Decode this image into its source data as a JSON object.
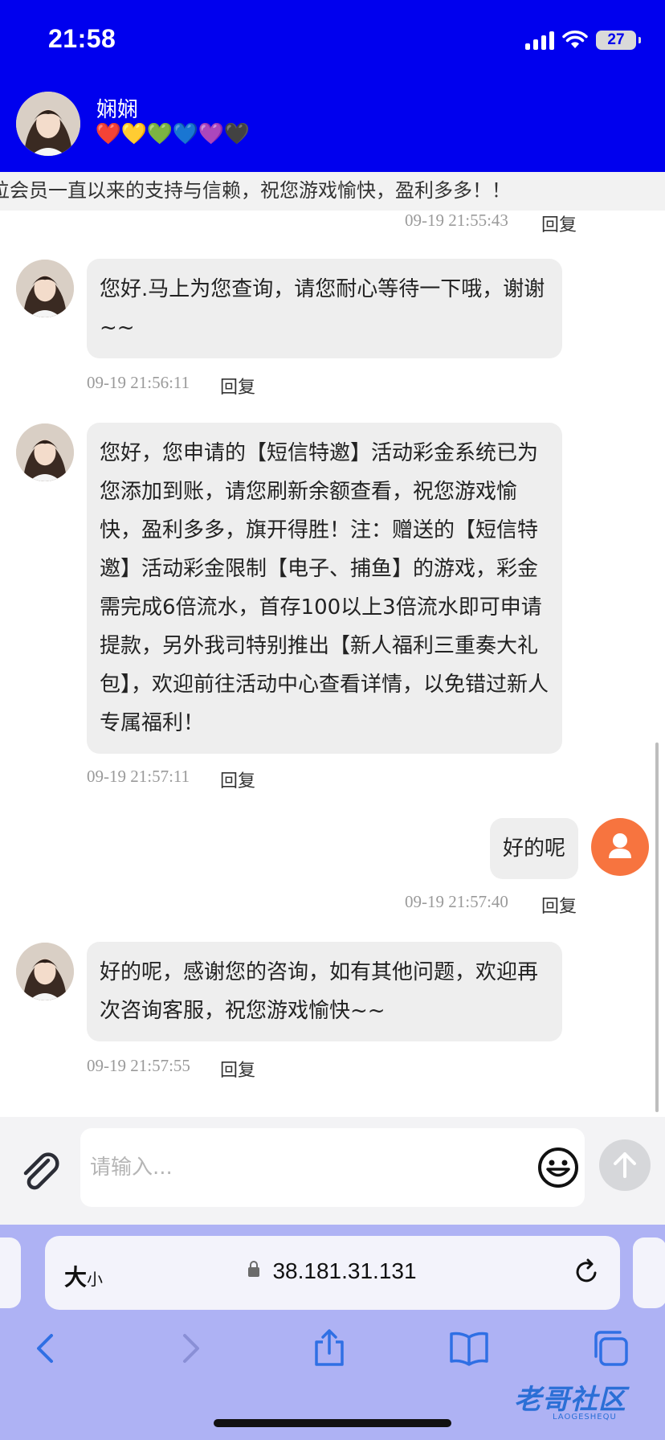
{
  "status_bar": {
    "time": "21:58",
    "battery": "27"
  },
  "header": {
    "name": "娴娴",
    "hearts": [
      "❤️",
      "💛",
      "💚",
      "💙",
      "💜",
      "🖤"
    ]
  },
  "notice": {
    "text": "位会员一直以来的支持与信赖，祝您游戏愉快，盈利多多！！"
  },
  "messages": [
    {
      "side": "right",
      "time": "09-19 21:55:43",
      "reply_label": "回复"
    },
    {
      "side": "left",
      "text": "您好.马上为您查询，请您耐心等待一下哦，谢谢~~",
      "time": "09-19 21:56:11",
      "reply_label": "回复"
    },
    {
      "side": "left",
      "text": "您好，您申请的【短信特邀】活动彩金系统已为您添加到账，请您刷新余额查看，祝您游戏愉快，盈利多多，旗开得胜！注：赠送的【短信特邀】活动彩金限制【电子、捕鱼】的游戏，彩金需完成6倍流水，首存100以上3倍流水即可申请提款，另外我司特别推出【新人福利三重奏大礼包】，欢迎前往活动中心查看详情，以免错过新人专属福利！",
      "time": "09-19 21:57:11",
      "reply_label": "回复"
    },
    {
      "side": "right",
      "text": "好的呢",
      "time": "09-19 21:57:40",
      "reply_label": "回复"
    },
    {
      "side": "left",
      "text": "好的呢，感谢您的咨询，如有其他问题，欢迎再次咨询客服，祝您游戏愉快~~",
      "time": "09-19 21:57:55",
      "reply_label": "回复"
    }
  ],
  "input": {
    "placeholder": "请输入..."
  },
  "browser": {
    "text_size_big": "大",
    "text_size_small": "小",
    "url": "38.181.31.131"
  },
  "watermark": {
    "text": "老哥社区",
    "sub": "LAOGESHEQU"
  },
  "icons": {
    "attach": "paperclip-icon",
    "emoji": "smiley-icon",
    "send": "arrow-up-icon",
    "back": "chevron-left-icon",
    "forward": "chevron-right-icon",
    "share": "share-icon",
    "bookmarks": "book-icon",
    "tabs": "tabs-icon",
    "reload": "reload-icon",
    "lock": "lock-icon"
  },
  "colors": {
    "header_bg": "#0000ee",
    "bubble_bg": "#eeeeee",
    "user_avatar": "#f7743f",
    "safari_bg": "#aeb2f4"
  }
}
